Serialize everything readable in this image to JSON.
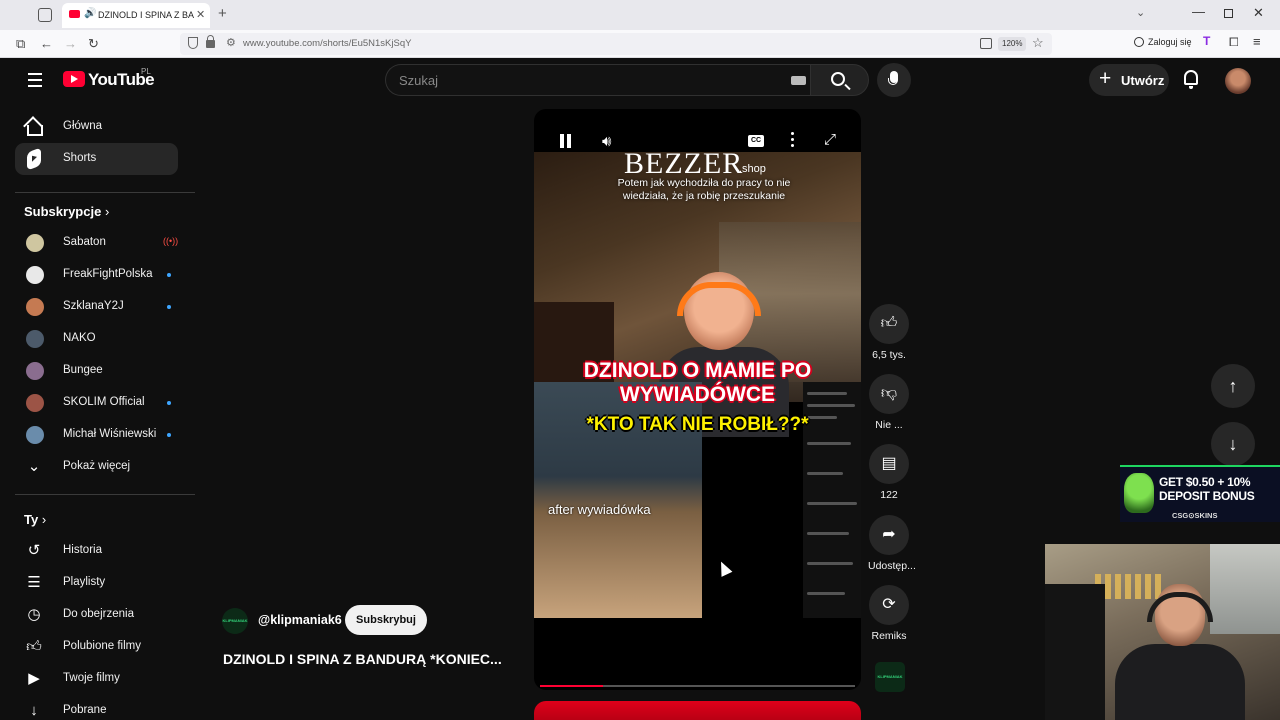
{
  "browser": {
    "tab_title": "DZINOLD I SPINA Z BANDURĄ",
    "url": "www.youtube.com/shorts/Eu5N1sKjSqY",
    "zoom": "120%",
    "signin_label": "Zaloguj się"
  },
  "header": {
    "logo_text": "YouTube",
    "country": "PL",
    "search_placeholder": "Szukaj",
    "create_label": "Utwórz"
  },
  "sidebar": {
    "main": [
      {
        "label": "Główna",
        "icon": "home-icon",
        "active": false
      },
      {
        "label": "Shorts",
        "icon": "shorts-icon",
        "active": true
      }
    ],
    "subscriptions_heading": "Subskrypcje",
    "subscriptions": [
      {
        "label": "Sabaton",
        "status": "live",
        "color": "#cfc6a0"
      },
      {
        "label": "FreakFightPolska",
        "status": "new",
        "color": "#e8e8e8"
      },
      {
        "label": "SzklanaY2J",
        "status": "new",
        "color": "#c57a52"
      },
      {
        "label": "NAKO",
        "status": "",
        "color": "#4c5a6a"
      },
      {
        "label": "Bungee",
        "status": "",
        "color": "#8a6d8f"
      },
      {
        "label": "SKOLIM Official",
        "status": "new",
        "color": "#9c5446"
      },
      {
        "label": "Michał Wiśniewski",
        "status": "new",
        "color": "#6a8cab"
      }
    ],
    "show_more": "Pokaż więcej",
    "you_heading": "Ty",
    "you_items": [
      {
        "label": "Historia",
        "icon": "history-icon"
      },
      {
        "label": "Playlisty",
        "icon": "playlist-icon"
      },
      {
        "label": "Do obejrzenia",
        "icon": "clock-icon"
      },
      {
        "label": "Polubione filmy",
        "icon": "thumb-up-icon"
      },
      {
        "label": "Twoje filmy",
        "icon": "video-icon"
      },
      {
        "label": "Pobrane",
        "icon": "download-icon"
      }
    ]
  },
  "short": {
    "overlay_logo": "BEZZER",
    "overlay_logo_sub": ".shop",
    "subtitle": "Potem jak wychodziła do pracy to nie wiedziała, że ja robię przeszukanie",
    "caption_main": "DZINOLD O MAMIE PO WYWIADÓWCE",
    "caption_sub": "*KTO TAK NIE ROBIŁ??*",
    "inner_caption": "after wywiadówka",
    "channel_name": "@klipmaniak6",
    "channel_avatar_text": "KLIPMANIAK",
    "subscribe_label": "Subskrybuj",
    "title": "DZINOLD I SPINA Z BANDURĄ *KONIEC...",
    "progress": 0.2
  },
  "actions": {
    "like_count": "6,5 tys.",
    "dislike_label": "Nie ...",
    "comments_count": "122",
    "share_label": "Udostęp...",
    "remix_label": "Remiks"
  },
  "overlays": {
    "ad_line1": "GET $0.50 + 10%",
    "ad_line2": "DEPOSIT BONUS",
    "ad_brand": "CSG⊙SKINS"
  }
}
